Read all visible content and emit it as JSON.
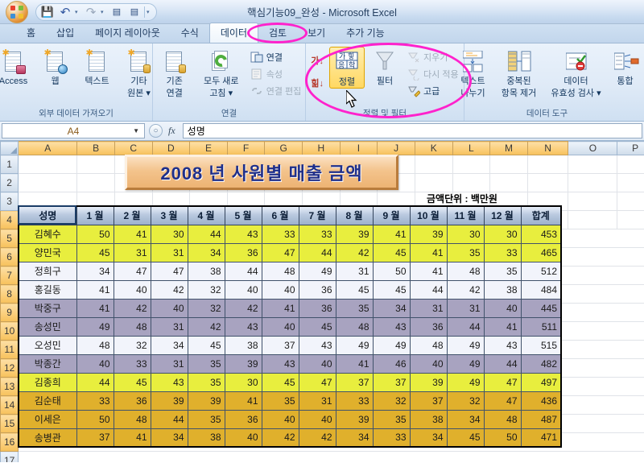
{
  "window": {
    "title": "핵심기능09_완성  -  Microsoft Excel",
    "office_button": "office-orb",
    "quick_access": [
      {
        "name": "save",
        "glyph": "💾"
      },
      {
        "name": "undo",
        "glyph": "↶"
      },
      {
        "name": "redo",
        "glyph": "↷"
      },
      {
        "name": "sort-asc",
        "glyph": "▤"
      },
      {
        "name": "sort-desc",
        "glyph": "▤"
      },
      {
        "name": "customize",
        "glyph": "▾"
      }
    ]
  },
  "tabs": [
    {
      "label": "홈",
      "active": false
    },
    {
      "label": "삽입",
      "active": false
    },
    {
      "label": "페이지 레이아웃",
      "active": false
    },
    {
      "label": "수식",
      "active": false
    },
    {
      "label": "데이터",
      "active": true
    },
    {
      "label": "검토",
      "active": false
    },
    {
      "label": "보기",
      "active": false
    },
    {
      "label": "추가 기능",
      "active": false
    }
  ],
  "ribbon": {
    "groups": [
      {
        "title": "외부 데이터 가져오기",
        "big_buttons": [
          {
            "label": "Access",
            "icon": "access-icon"
          },
          {
            "label": "웹",
            "icon": "web-icon"
          },
          {
            "label": "텍스트",
            "icon": "text-icon"
          },
          {
            "label": "기타\n원본 ▾",
            "l1": "기타",
            "l2": "원본 ▾",
            "icon": "other-sources-icon"
          }
        ]
      },
      {
        "title": "연결",
        "big_buttons": [
          {
            "l1": "기존",
            "l2": "연결",
            "icon": "existing-connections-icon"
          },
          {
            "l1": "모두 새로",
            "l2": "고침 ▾",
            "icon": "refresh-all-icon"
          }
        ],
        "small_buttons": [
          {
            "label": "연결",
            "icon": "connections-icon",
            "disabled": false
          },
          {
            "label": "속성",
            "icon": "properties-icon",
            "disabled": true
          },
          {
            "label": "연결 편집",
            "icon": "edit-links-icon",
            "disabled": true
          }
        ]
      },
      {
        "title": "정렬 및 필터",
        "sort_az": "가↓",
        "sort_za": "힒↓",
        "big_buttons": [
          {
            "label": "정렬",
            "icon": "sort-icon",
            "selected": true
          },
          {
            "label": "필터",
            "icon": "filter-icon",
            "selected": false
          }
        ],
        "small_buttons": [
          {
            "label": "지우기",
            "icon": "clear-filter-icon",
            "disabled": true
          },
          {
            "label": "다시 적용",
            "icon": "reapply-icon",
            "disabled": true
          },
          {
            "label": "고급",
            "icon": "advanced-filter-icon",
            "disabled": false
          }
        ]
      },
      {
        "title": "데이터 도구",
        "big_buttons": [
          {
            "l1": "텍스트",
            "l2": "나누기",
            "icon": "text-to-columns-icon"
          },
          {
            "l1": "중복된",
            "l2": "항목 제거",
            "icon": "remove-duplicates-icon"
          },
          {
            "l1": "데이터",
            "l2": "유효성 검사 ▾",
            "icon": "data-validation-icon"
          },
          {
            "l1": "통합",
            "l2": "",
            "icon": "consolidate-icon"
          }
        ]
      }
    ]
  },
  "formula_bar": {
    "name_box": "A4",
    "fx_label": "fx",
    "content": "성명"
  },
  "grid": {
    "columns": [
      "A",
      "B",
      "C",
      "D",
      "E",
      "F",
      "G",
      "H",
      "I",
      "J",
      "K",
      "L",
      "M",
      "N",
      "O",
      "P"
    ],
    "rows": [
      "1",
      "2",
      "3",
      "4",
      "5",
      "6",
      "7",
      "8",
      "9",
      "10",
      "11",
      "12",
      "13",
      "14",
      "15",
      "16",
      "17"
    ],
    "banner_title": "2008 년 사원별 매출 금액",
    "unit_label": "금액단위 : 백만원",
    "selected_cell": "A4"
  },
  "table_data": {
    "headers": [
      "성명",
      "1 월",
      "2 월",
      "3 월",
      "4 월",
      "5 월",
      "6 월",
      "7 월",
      "8 월",
      "9 월",
      "10 월",
      "11 월",
      "12 월",
      "합계"
    ],
    "rows": [
      {
        "style": "r-yellow",
        "cells": [
          "김혜수",
          50,
          41,
          30,
          44,
          43,
          33,
          33,
          39,
          41,
          39,
          30,
          30,
          453
        ]
      },
      {
        "style": "r-yellow",
        "cells": [
          "양민국",
          45,
          31,
          31,
          34,
          36,
          47,
          44,
          42,
          45,
          41,
          35,
          33,
          465
        ]
      },
      {
        "style": "r-white",
        "cells": [
          "정희구",
          34,
          47,
          47,
          38,
          44,
          48,
          49,
          31,
          50,
          41,
          48,
          35,
          512
        ]
      },
      {
        "style": "r-white",
        "cells": [
          "홍길동",
          41,
          40,
          42,
          32,
          40,
          40,
          36,
          45,
          45,
          44,
          42,
          38,
          484
        ]
      },
      {
        "style": "r-purple",
        "cells": [
          "박중구",
          41,
          42,
          40,
          32,
          42,
          41,
          36,
          35,
          34,
          31,
          31,
          40,
          445
        ]
      },
      {
        "style": "r-purple",
        "cells": [
          "송성민",
          49,
          48,
          31,
          42,
          43,
          40,
          45,
          48,
          43,
          36,
          44,
          41,
          511
        ]
      },
      {
        "style": "r-white",
        "cells": [
          "오성민",
          48,
          32,
          34,
          45,
          38,
          37,
          43,
          49,
          49,
          48,
          49,
          43,
          515
        ]
      },
      {
        "style": "r-purple",
        "cells": [
          "박종간",
          40,
          33,
          31,
          35,
          39,
          43,
          40,
          41,
          46,
          40,
          49,
          44,
          482
        ]
      },
      {
        "style": "r-yellow",
        "cells": [
          "김종희",
          44,
          45,
          43,
          35,
          30,
          45,
          47,
          37,
          37,
          39,
          49,
          47,
          497
        ]
      },
      {
        "style": "r-gold",
        "cells": [
          "김순태",
          33,
          36,
          39,
          39,
          41,
          35,
          31,
          33,
          32,
          37,
          32,
          47,
          436
        ]
      },
      {
        "style": "r-gold",
        "cells": [
          "이세은",
          50,
          48,
          44,
          35,
          36,
          40,
          40,
          39,
          35,
          38,
          34,
          48,
          487
        ]
      },
      {
        "style": "r-gold",
        "cells": [
          "송병관",
          37,
          41,
          34,
          38,
          40,
          42,
          42,
          34,
          33,
          34,
          45,
          50,
          471
        ]
      }
    ]
  },
  "annotations": [
    {
      "name": "data-tab-highlight",
      "shape": "ellipse"
    },
    {
      "name": "sort-filter-group-highlight",
      "shape": "ellipse"
    }
  ]
}
